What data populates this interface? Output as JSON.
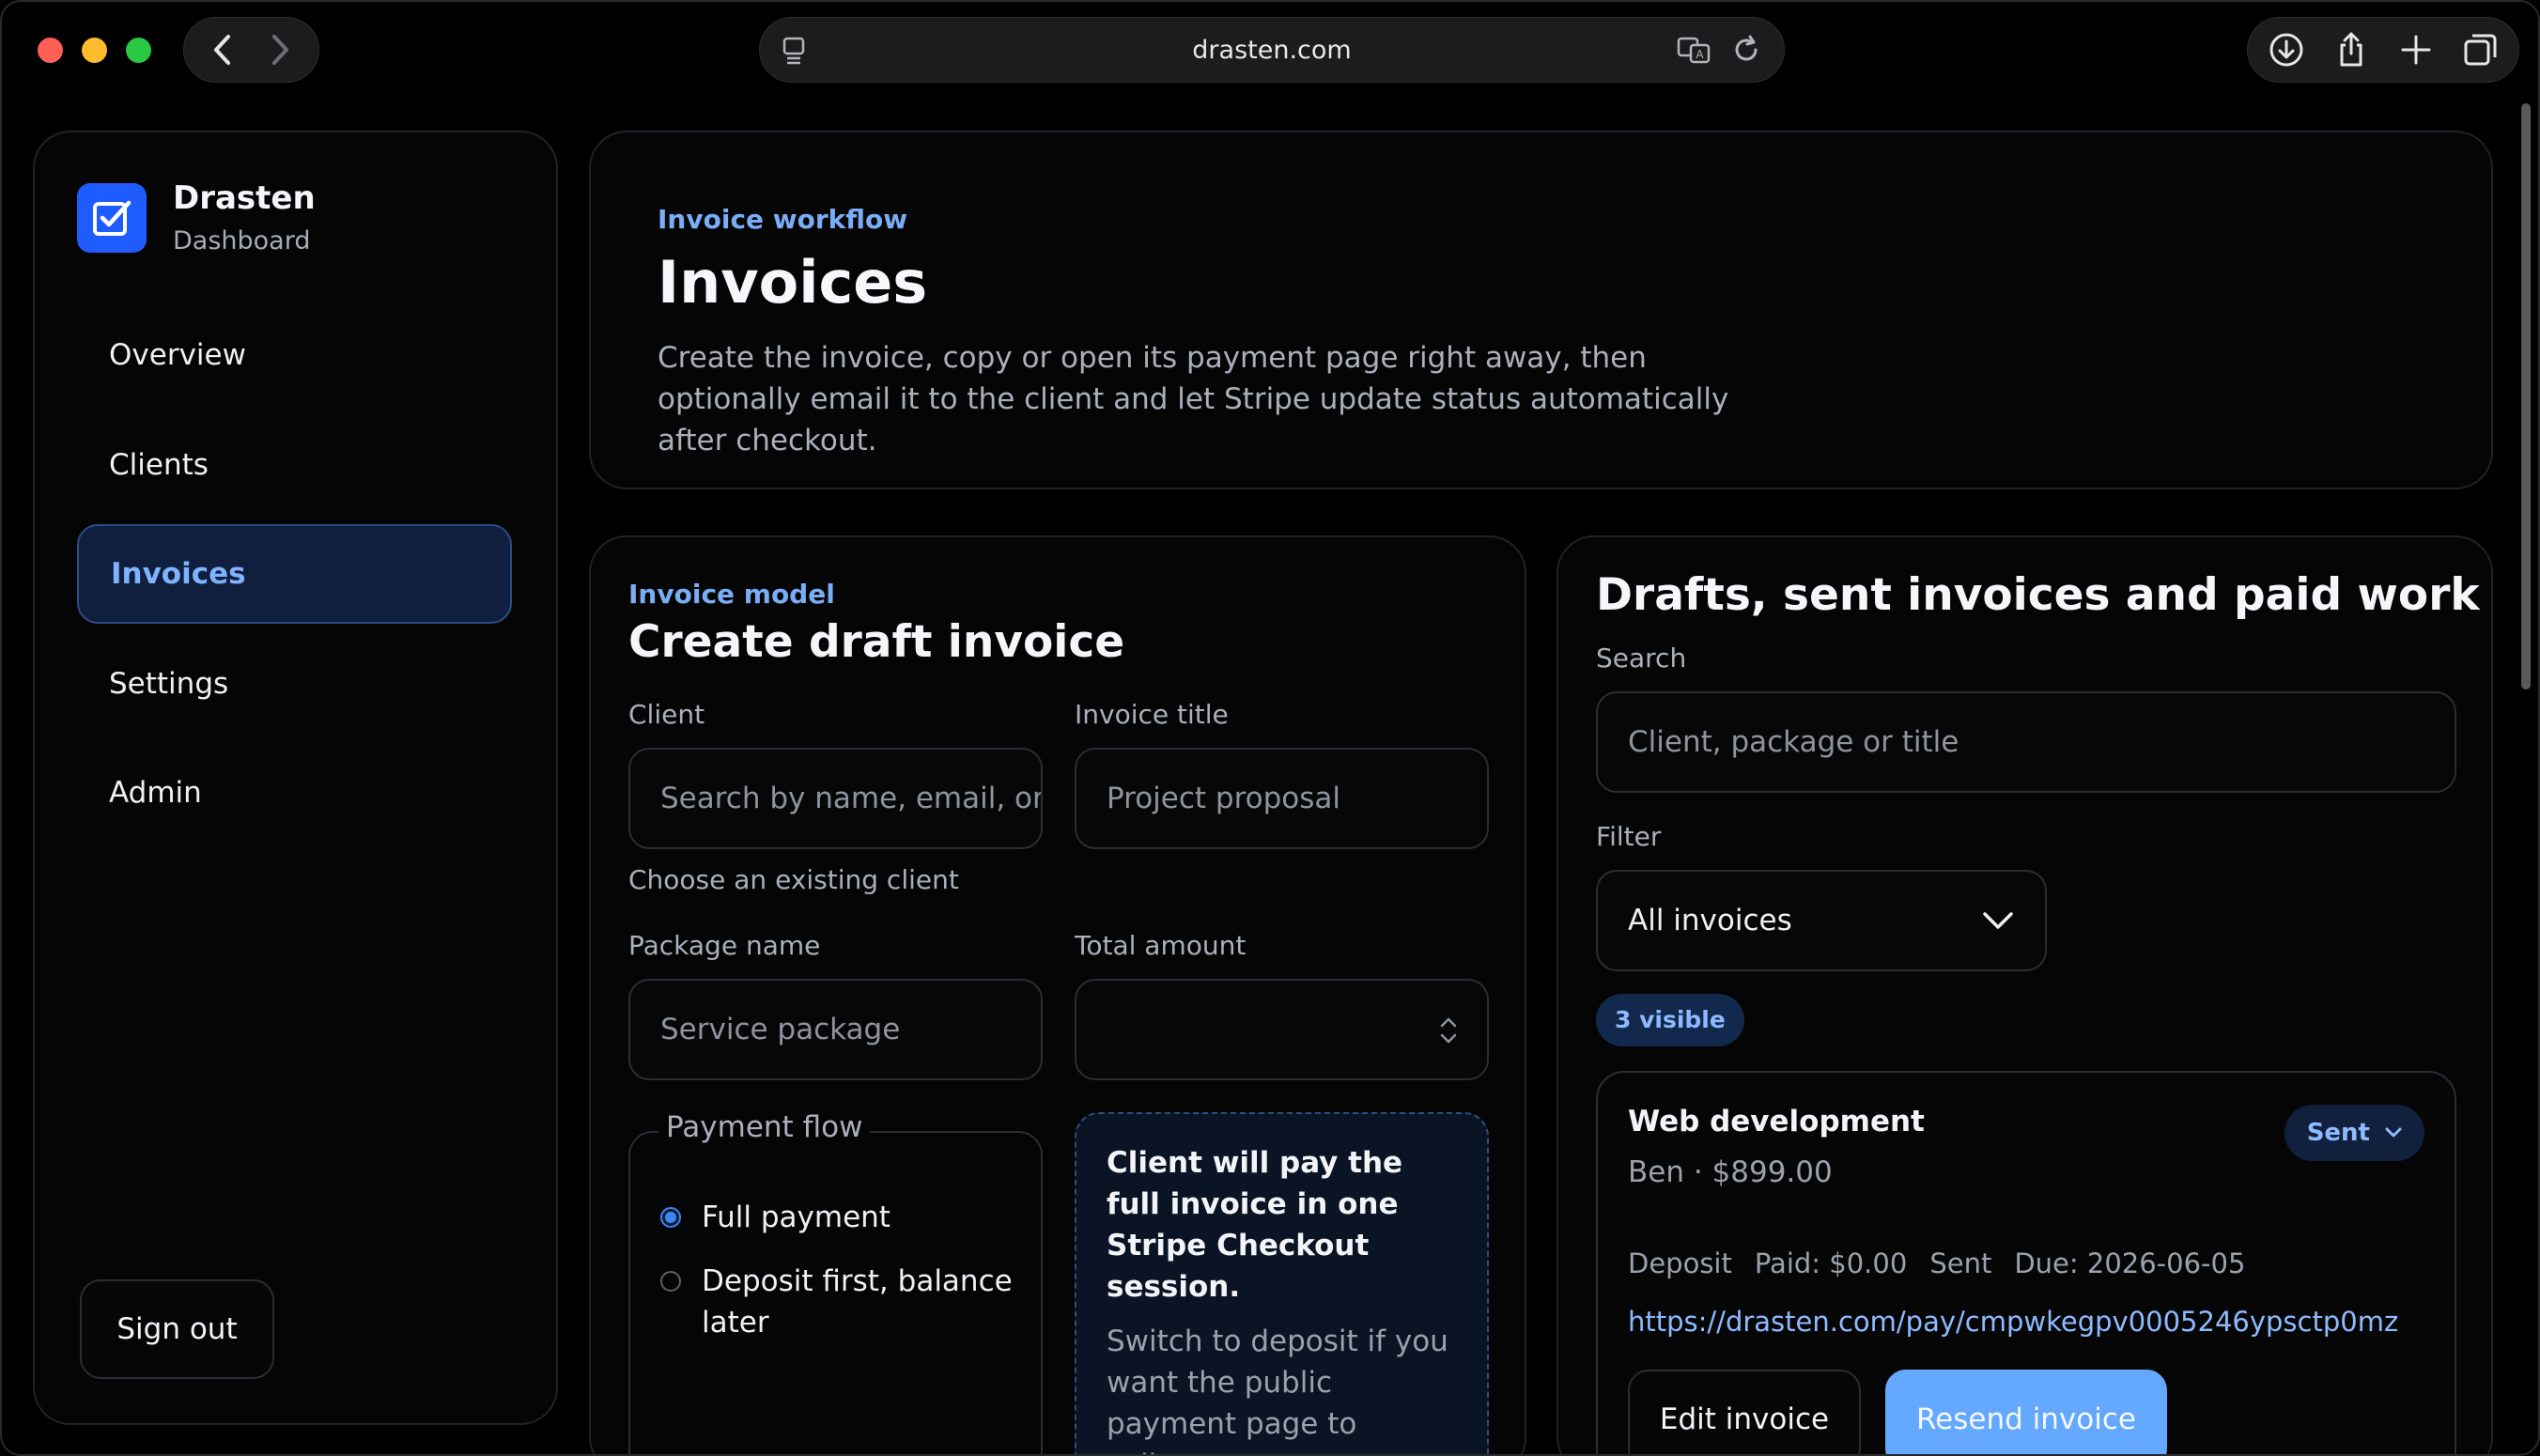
{
  "browser": {
    "url": "drasten.com"
  },
  "brand": {
    "name": "Drasten",
    "subtitle": "Dashboard",
    "accent": "#1f5cff"
  },
  "sidebar": {
    "items": [
      {
        "label": "Overview",
        "active": false
      },
      {
        "label": "Clients",
        "active": false
      },
      {
        "label": "Invoices",
        "active": true
      },
      {
        "label": "Settings",
        "active": false
      },
      {
        "label": "Admin",
        "active": false
      }
    ],
    "sign_out": "Sign out"
  },
  "header": {
    "eyebrow": "Invoice workflow",
    "title": "Invoices",
    "description": "Create the invoice, copy or open its payment page right away, then optionally email it to the client and let Stripe update status automatically after checkout."
  },
  "create": {
    "eyebrow": "Invoice model",
    "title": "Create draft invoice",
    "client_label": "Client",
    "client_placeholder": "Search by name, email, or",
    "client_hint": "Choose an existing client",
    "invoice_title_label": "Invoice title",
    "invoice_title_placeholder": "Project proposal",
    "package_label": "Package name",
    "package_placeholder": "Service package",
    "amount_label": "Total amount",
    "amount_value": "",
    "payment_flow_label": "Payment flow",
    "options": [
      {
        "label": "Full payment",
        "selected": true
      },
      {
        "label": "Deposit first, balance later",
        "selected": false
      }
    ],
    "info_title": "Client will pay the full invoice in one Stripe Checkout session.",
    "info_body": "Switch to deposit if you want the public payment page to collect two installments."
  },
  "list": {
    "title": "Drafts, sent invoices and paid work",
    "search_label": "Search",
    "search_placeholder": "Client, package or title",
    "filter_label": "Filter",
    "filter_value": "All invoices",
    "visible_badge": "3 visible",
    "invoices": [
      {
        "title": "Web development",
        "subtitle": "Ben · $899.00",
        "status": "Sent",
        "meta": [
          "Deposit",
          "Paid: $0.00",
          "Sent",
          "Due: 2026-06-05"
        ],
        "link": "https://drasten.com/pay/cmpwkegpv0005246ypsctp0mz",
        "edit_label": "Edit invoice",
        "resend_label": "Resend invoice"
      }
    ]
  }
}
